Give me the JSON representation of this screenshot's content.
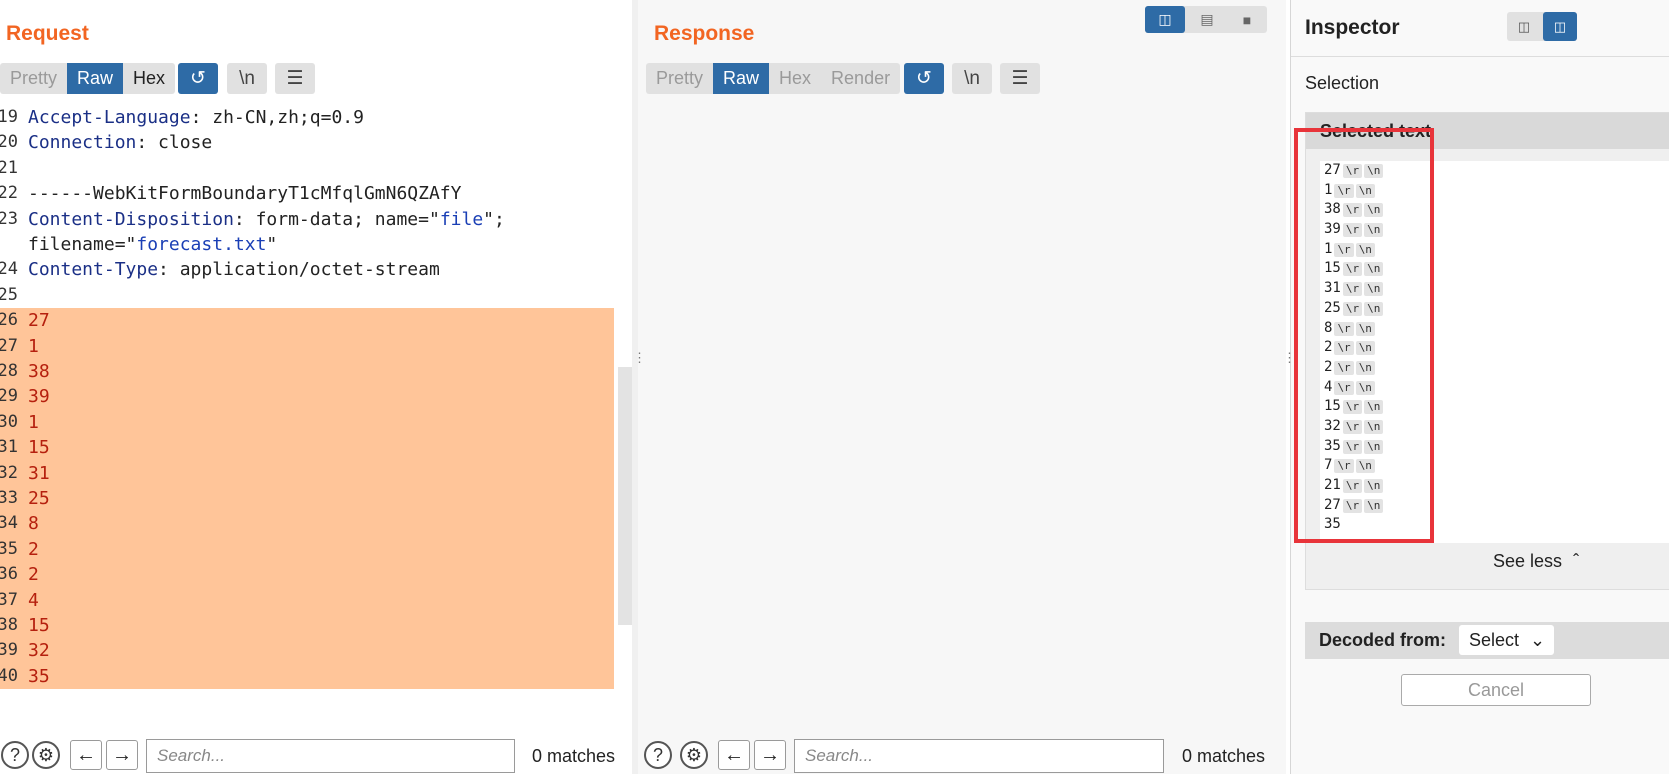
{
  "layout_buttons": [
    "split-vertical",
    "split-horizontal",
    "single"
  ],
  "request": {
    "title": "Request",
    "tabs": [
      {
        "label": "Pretty",
        "active": false
      },
      {
        "label": "Raw",
        "active": true
      },
      {
        "label": "Hex",
        "active": false
      }
    ],
    "newline_button": "\\n",
    "lines": [
      {
        "n": "19",
        "key": "Accept-Language",
        "rest": ": zh-CN,zh;q=0.9"
      },
      {
        "n": "20",
        "key": "Connection",
        "rest": ": close"
      },
      {
        "n": "21",
        "text": ""
      },
      {
        "n": "22",
        "text": "------WebKitFormBoundaryT1cMfqlGmN6QZAfY"
      },
      {
        "n": "23",
        "key": "Content-Disposition",
        "rest": ": form-data; name=\"",
        "s1": "file",
        "rest2": "\";"
      },
      {
        "n": "",
        "pre": "filename=\"",
        "s1": "forecast.txt",
        "rest2": "\""
      },
      {
        "n": "24",
        "key": "Content-Type",
        "rest": ": application/octet-stream"
      },
      {
        "n": "25",
        "text": ""
      },
      {
        "n": "26",
        "text": "27",
        "hl": true
      },
      {
        "n": "27",
        "text": "1",
        "hl": true
      },
      {
        "n": "28",
        "text": "38",
        "hl": true
      },
      {
        "n": "29",
        "text": "39",
        "hl": true
      },
      {
        "n": "30",
        "text": "1",
        "hl": true
      },
      {
        "n": "31",
        "text": "15",
        "hl": true
      },
      {
        "n": "32",
        "text": "31",
        "hl": true
      },
      {
        "n": "33",
        "text": "25",
        "hl": true
      },
      {
        "n": "34",
        "text": "8",
        "hl": true
      },
      {
        "n": "35",
        "text": "2",
        "hl": true
      },
      {
        "n": "36",
        "text": "2",
        "hl": true
      },
      {
        "n": "37",
        "text": "4",
        "hl": true
      },
      {
        "n": "38",
        "text": "15",
        "hl": true
      },
      {
        "n": "39",
        "text": "32",
        "hl": true
      },
      {
        "n": "40",
        "text": "35",
        "hl": true
      }
    ],
    "search_placeholder": "Search...",
    "matches": "0 matches"
  },
  "response": {
    "title": "Response",
    "tabs": [
      {
        "label": "Pretty",
        "active": false
      },
      {
        "label": "Raw",
        "active": true
      },
      {
        "label": "Hex",
        "active": false
      },
      {
        "label": "Render",
        "active": false
      }
    ],
    "newline_button": "\\n",
    "search_placeholder": "Search...",
    "matches": "0 matches"
  },
  "inspector": {
    "title": "Inspector",
    "selection_label": "Selection",
    "selected_text_header": "Selected text",
    "selected_values": [
      "27",
      "1",
      "38",
      "39",
      "1",
      "15",
      "31",
      "25",
      "8",
      "2",
      "2",
      "4",
      "15",
      "32",
      "35",
      "7",
      "21",
      "27",
      "35"
    ],
    "cr_chip": "\\r",
    "lf_chip": "\\n",
    "see_less": "See less",
    "decoded_from_label": "Decoded from:",
    "decoded_select": "Select",
    "cancel_label": "Cancel"
  },
  "colors": {
    "accent_orange": "#f26522",
    "tab_blue": "#2e6ba6",
    "highlight": "#ffc599",
    "annotation_red": "#e8343a"
  }
}
